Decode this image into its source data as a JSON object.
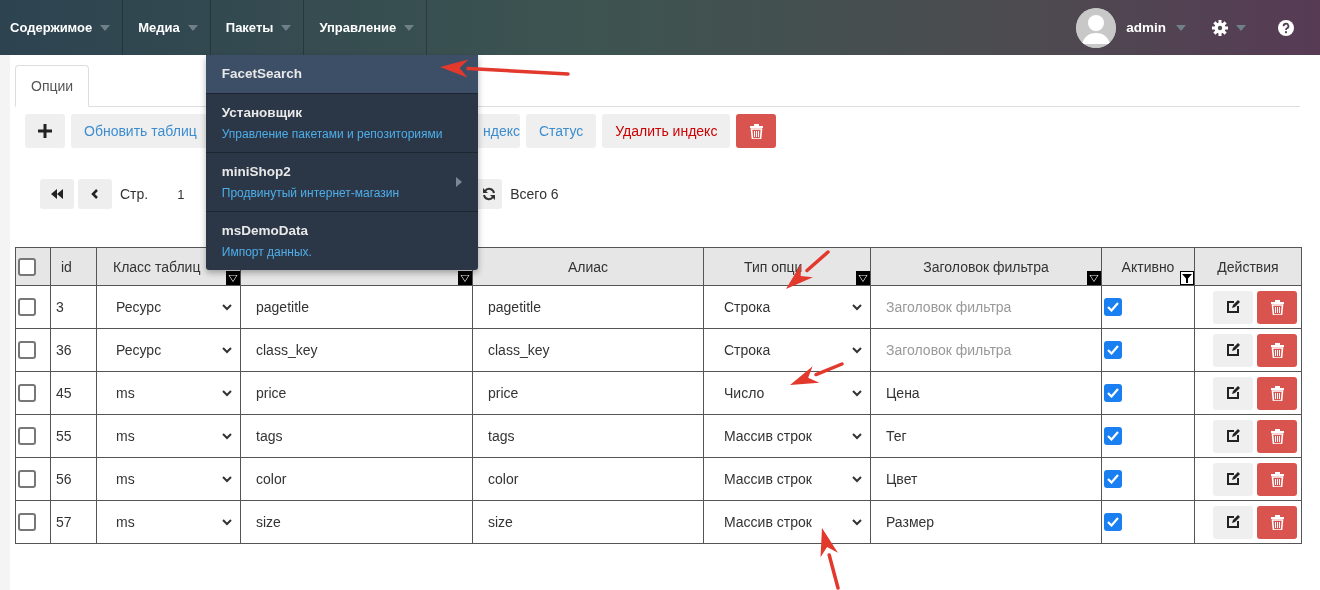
{
  "top_nav": {
    "menus": [
      {
        "label": "Содержимое"
      },
      {
        "label": "Медиа"
      },
      {
        "label": "Пакеты",
        "dropdown": [
          {
            "title": "FacetSearch",
            "selected": true,
            "submenu": false
          },
          {
            "title": "Установщик",
            "description": "Управление пакетами и репозиториями",
            "selected": false,
            "submenu": false
          },
          {
            "title": "miniShop2",
            "description": "Продвинутый интернет-магазин",
            "selected": false,
            "submenu": true
          },
          {
            "title": "msDemoData",
            "description": "Импорт данных.",
            "selected": false,
            "submenu": false
          }
        ]
      },
      {
        "label": "Управление"
      }
    ],
    "user": {
      "name": "admin"
    }
  },
  "tabs": [
    {
      "label": "Опции",
      "selected": true
    }
  ],
  "toolbar": [
    {
      "kind": "add"
    },
    {
      "kind": "text",
      "label": "Обновить таблиц"
    },
    {
      "kind": "text",
      "label": "ндекс"
    },
    {
      "kind": "text",
      "label": "Статус"
    },
    {
      "kind": "danger_text",
      "label": "Удалить индекс"
    },
    {
      "kind": "delete"
    }
  ],
  "pagination": {
    "page_label": "Стр.",
    "page": "1",
    "total": "Всего 6"
  },
  "table": {
    "select_all": {
      "checked": false
    },
    "columns": [
      {
        "label": "id",
        "kind": "plain"
      },
      {
        "label": "Класс таблиц",
        "kind": "dropdown"
      },
      {
        "kind": "dropdown"
      },
      {
        "label": "Алиас",
        "kind": "plain"
      },
      {
        "label": "Тип опци",
        "kind": "dropdown"
      },
      {
        "label": "Заголовок фильтра",
        "kind": "dropdown"
      },
      {
        "label": "Активно",
        "kind": "filter"
      },
      {
        "label": "Действия",
        "kind": "plain"
      }
    ],
    "rows": [
      {
        "selected": false,
        "id": "3",
        "class": "Ресурс",
        "key": "pagetitle",
        "alias": "pagetitle",
        "type": "Строка",
        "title_placeholder": "Заголовок фильтра",
        "active": true
      },
      {
        "selected": false,
        "id": "36",
        "class": "Ресурс",
        "key": "class_key",
        "alias": "class_key",
        "type": "Строка",
        "title_placeholder": "Заголовок фильтра",
        "active": true
      },
      {
        "selected": false,
        "id": "45",
        "class": "ms",
        "key": "price",
        "alias": "price",
        "type": "Число",
        "title": "Цена",
        "active": true
      },
      {
        "selected": false,
        "id": "55",
        "class": "ms",
        "key": "tags",
        "alias": "tags",
        "type": "Массив строк",
        "title": "Тег",
        "active": true
      },
      {
        "selected": false,
        "id": "56",
        "class": "ms",
        "key": "color",
        "alias": "color",
        "type": "Массив строк",
        "title": "Цвет",
        "active": true
      },
      {
        "selected": false,
        "id": "57",
        "class": "ms",
        "key": "size",
        "alias": "size",
        "type": "Массив строк",
        "title": "Размер",
        "active": true
      }
    ]
  }
}
